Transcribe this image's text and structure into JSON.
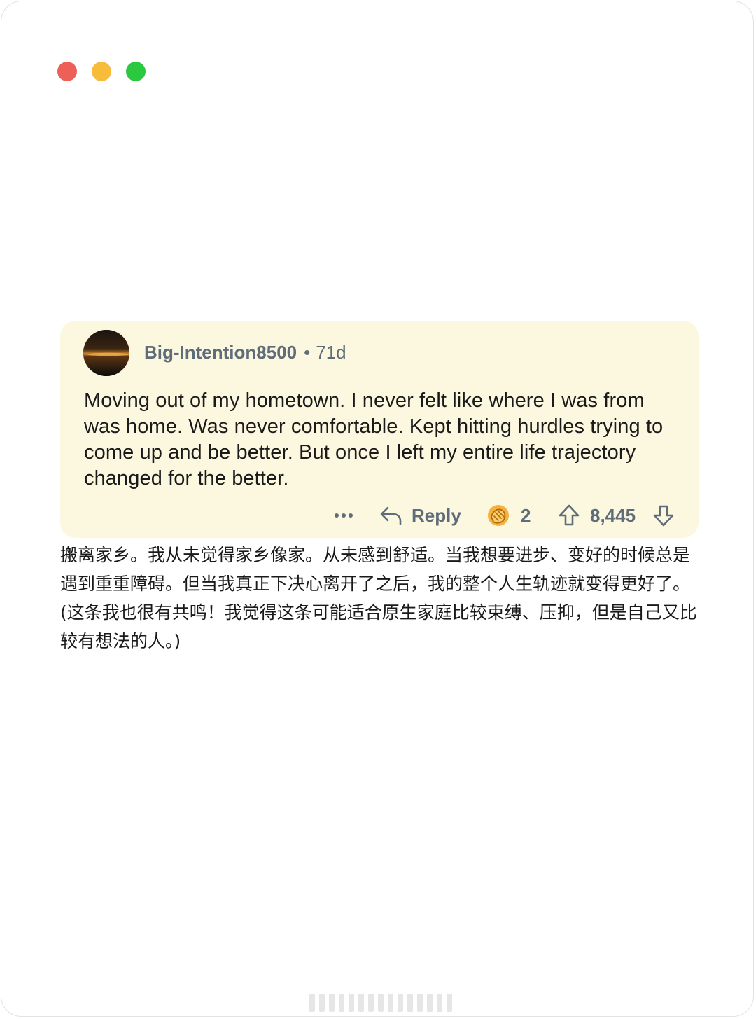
{
  "window": {
    "controls": [
      {
        "name": "close",
        "color": "#ee5f57"
      },
      {
        "name": "minimize",
        "color": "#f8bc3b"
      },
      {
        "name": "maximize",
        "color": "#2bc840"
      }
    ]
  },
  "comment": {
    "username": "Big-Intention8500",
    "separator": "•",
    "age": "71d",
    "body": "Moving out of my hometown. I never felt like where I was from was home. Was never comfortable. Kept hitting hurdles trying to come up and be better. But once I left my entire life trajectory changed for the better.",
    "actions": {
      "more_icon": "more-dots-icon",
      "reply_label": "Reply",
      "award_count": "2",
      "vote_count": "8,445"
    }
  },
  "translation": {
    "paragraph_1": "搬离家乡。我从未觉得家乡像家。从未感到舒适。当我想要进步、变好的时候总是遇到重重障碍。但当我真正下决心离开了之后，我的整个人生轨迹就变得更好了。",
    "paragraph_2": "(这条我也很有共鸣！我觉得这条可能适合原生家庭比较束缚、压抑，但是自己又比较有想法的人。)"
  },
  "colors": {
    "card_background": "#fcf7df",
    "meta_text": "#5f6c79",
    "body_text": "#1a1a1b"
  }
}
